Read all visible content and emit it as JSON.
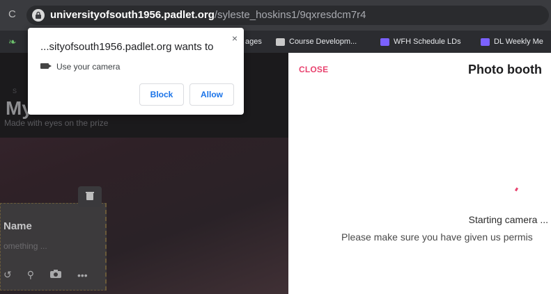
{
  "address_bar": {
    "url_host": "universityofsouth1956.padlet.org",
    "url_path": "/syleste_hoskins1/9qxresdcm7r4"
  },
  "bookmarks": [
    {
      "label": "ages",
      "icon": "folder-icon"
    },
    {
      "label": "Course Developm...",
      "icon": "folder-icon"
    },
    {
      "label": "WFH Schedule LDs",
      "icon": "app-icon"
    },
    {
      "label": "DL Weekly Me",
      "icon": "app-icon"
    }
  ],
  "permission_prompt": {
    "title": "...sityofsouth1956.padlet.org wants to",
    "request": "Use your camera",
    "block_label": "Block",
    "allow_label": "Allow",
    "close_glyph": "×"
  },
  "padlet": {
    "title": "My",
    "subtitle": "Made with eyes on the prize",
    "post": {
      "name": "Name",
      "placeholder": "omething ..."
    }
  },
  "photo_booth": {
    "close_label": "CLOSE",
    "title": "Photo booth",
    "status": "Starting camera ...",
    "hint": "Please make sure you have given us permis"
  },
  "colors": {
    "accent_pink": "#e8436f",
    "button_blue": "#1a73e8",
    "toolbar_dark": "#3a3b3f"
  }
}
